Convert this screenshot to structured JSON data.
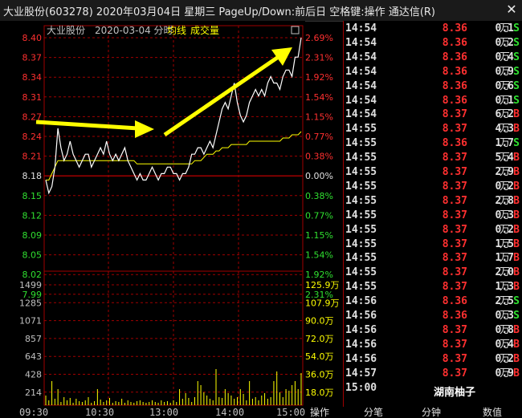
{
  "window": {
    "title": "大业股份(603278) 2020年03月04日 星期三 PageUp/Down:前后日 空格键:操作 通达信(R)",
    "close_label": "✕"
  },
  "chart": {
    "stock_name": "大业股份",
    "date": "2020-03-04 分时",
    "avg_line_label": "均线",
    "volume_label": "成交量",
    "base_price": 8.18
  },
  "chart_data": {
    "type": "line",
    "price_ticks": [
      "8.40",
      "8.37",
      "8.34",
      "8.31",
      "8.27",
      "8.24",
      "8.21",
      "8.18",
      "8.15",
      "8.12",
      "8.09",
      "8.05",
      "8.02",
      "7.99"
    ],
    "pct_ticks": [
      "2.69%",
      "2.31%",
      "1.92%",
      "1.54%",
      "1.15%",
      "0.77%",
      "0.38%",
      "0.00%",
      "0.38%",
      "0.77%",
      "1.15%",
      "1.54%",
      "1.92%",
      "2.31%"
    ],
    "volume_ticks": [
      "1499",
      "1285",
      "1071",
      "857",
      "643",
      "428",
      "214"
    ],
    "volume_amount_ticks": [
      "125.9万",
      "107.9万",
      "90.0万",
      "72.0万",
      "54.0万",
      "36.0万",
      "18.0万"
    ],
    "x_ticks": [
      "09:30",
      "10:30",
      "13:00",
      "14:00",
      "15:00"
    ],
    "ylim": [
      7.96,
      8.4
    ],
    "series": [
      {
        "name": "price",
        "values": [
          8.18,
          8.16,
          8.17,
          8.2,
          8.26,
          8.23,
          8.21,
          8.22,
          8.24,
          8.22,
          8.21,
          8.2,
          8.21,
          8.22,
          8.22,
          8.2,
          8.21,
          8.22,
          8.23,
          8.22,
          8.24,
          8.22,
          8.21,
          8.22,
          8.21,
          8.22,
          8.23,
          8.21,
          8.2,
          8.19,
          8.18,
          8.19,
          8.18,
          8.18,
          8.19,
          8.2,
          8.19,
          8.18,
          8.19,
          8.19,
          8.2,
          8.2,
          8.19,
          8.19,
          8.18,
          8.19,
          8.19,
          8.2,
          8.22,
          8.22,
          8.23,
          8.23,
          8.22,
          8.23,
          8.24,
          8.23,
          8.25,
          8.27,
          8.29,
          8.3,
          8.29,
          8.31,
          8.33,
          8.3,
          8.28,
          8.27,
          8.28,
          8.3,
          8.31,
          8.32,
          8.31,
          8.32,
          8.31,
          8.33,
          8.34,
          8.33,
          8.33,
          8.32,
          8.34,
          8.35,
          8.35,
          8.34,
          8.37,
          8.37,
          8.4
        ]
      },
      {
        "name": "avg",
        "values": [
          8.18,
          8.18,
          8.19,
          8.2,
          8.21,
          8.21,
          8.21,
          8.21,
          8.21,
          8.21,
          8.21,
          8.21,
          8.21,
          8.21,
          8.21,
          8.21,
          8.21,
          8.21,
          8.21,
          8.21,
          8.21,
          8.21,
          8.21,
          8.21,
          8.21,
          8.21,
          8.21,
          8.21,
          8.21,
          8.21,
          8.205,
          8.205,
          8.205,
          8.205,
          8.205,
          8.205,
          8.205,
          8.205,
          8.205,
          8.205,
          8.205,
          8.205,
          8.205,
          8.205,
          8.205,
          8.205,
          8.205,
          8.205,
          8.205,
          8.21,
          8.21,
          8.21,
          8.215,
          8.22,
          8.22,
          8.22,
          8.225,
          8.225,
          8.23,
          8.23,
          8.23,
          8.235,
          8.235,
          8.235,
          8.235,
          8.235,
          8.235,
          8.24,
          8.24,
          8.24,
          8.24,
          8.24,
          8.24,
          8.24,
          8.24,
          8.24,
          8.24,
          8.24,
          8.245,
          8.245,
          8.245,
          8.25,
          8.25,
          8.25,
          8.255
        ]
      }
    ],
    "volumes": [
      120,
      60,
      300,
      80,
      200,
      40,
      100,
      60,
      90,
      30,
      80,
      50,
      40,
      60,
      100,
      30,
      50,
      200,
      70,
      40,
      60,
      90,
      30,
      50,
      40,
      80,
      30,
      60,
      40,
      30,
      50,
      60,
      40,
      30,
      40,
      60,
      40,
      30,
      60,
      40,
      50,
      30,
      60,
      40,
      200,
      80,
      150,
      90,
      40,
      100,
      300,
      250,
      160,
      120,
      80,
      60,
      450,
      100,
      90,
      200,
      150,
      120,
      80,
      100,
      200,
      140,
      60,
      300,
      80,
      100,
      60,
      120,
      150,
      80,
      100,
      300,
      420,
      160,
      100,
      200,
      180,
      250,
      300,
      200,
      400
    ]
  },
  "trades": [
    {
      "time": "14:54",
      "price": "8.36",
      "vol": "0.1",
      "unit": "万",
      "side": "S"
    },
    {
      "time": "14:54",
      "price": "8.36",
      "vol": "0.2",
      "unit": "万",
      "side": "S"
    },
    {
      "time": "14:54",
      "price": "8.36",
      "vol": "0.4",
      "unit": "万",
      "side": "S"
    },
    {
      "time": "14:54",
      "price": "8.36",
      "vol": "0.9",
      "unit": "万",
      "side": "S"
    },
    {
      "time": "14:54",
      "price": "8.36",
      "vol": "0.6",
      "unit": "万",
      "side": "S"
    },
    {
      "time": "14:54",
      "price": "8.36",
      "vol": "0.1",
      "unit": "万",
      "side": "S"
    },
    {
      "time": "14:54",
      "price": "8.37",
      "vol": "6.2",
      "unit": "万",
      "side": "B"
    },
    {
      "time": "14:55",
      "price": "8.37",
      "vol": "4.3",
      "unit": "万",
      "side": "B"
    },
    {
      "time": "14:55",
      "price": "8.36",
      "vol": "1.7",
      "unit": "万",
      "side": "S"
    },
    {
      "time": "14:55",
      "price": "8.37",
      "vol": "5.4",
      "unit": "万",
      "side": "B"
    },
    {
      "time": "14:55",
      "price": "8.37",
      "vol": "2.9",
      "unit": "万",
      "side": "B"
    },
    {
      "time": "14:55",
      "price": "8.37",
      "vol": "0.2",
      "unit": "万",
      "side": "B"
    },
    {
      "time": "14:55",
      "price": "8.37",
      "vol": "2.8",
      "unit": "万",
      "side": "B"
    },
    {
      "time": "14:55",
      "price": "8.37",
      "vol": "0.3",
      "unit": "万",
      "side": "B"
    },
    {
      "time": "14:55",
      "price": "8.37",
      "vol": "0.2",
      "unit": "万",
      "side": "B"
    },
    {
      "time": "14:55",
      "price": "8.37",
      "vol": "1.5",
      "unit": "万",
      "side": "B"
    },
    {
      "time": "14:55",
      "price": "8.37",
      "vol": "1.7",
      "unit": "万",
      "side": "B"
    },
    {
      "time": "14:55",
      "price": "8.37",
      "vol": "2.0",
      "unit": "万",
      "side": "B"
    },
    {
      "time": "14:55",
      "price": "8.37",
      "vol": "1.3",
      "unit": "万",
      "side": "B"
    },
    {
      "time": "14:56",
      "price": "8.36",
      "vol": "2.5",
      "unit": "万",
      "side": "S"
    },
    {
      "time": "14:56",
      "price": "8.36",
      "vol": "0.3",
      "unit": "万",
      "side": "S"
    },
    {
      "time": "14:56",
      "price": "8.37",
      "vol": "0.8",
      "unit": "万",
      "side": "B"
    },
    {
      "time": "14:56",
      "price": "8.37",
      "vol": "0.4",
      "unit": "万",
      "side": "B"
    },
    {
      "time": "14:56",
      "price": "8.37",
      "vol": "0.2",
      "unit": "万",
      "side": "B"
    },
    {
      "time": "14:57",
      "price": "8.37",
      "vol": "0.9",
      "unit": "万",
      "side": "B"
    },
    {
      "time": "15:00",
      "price": "",
      "vol": "",
      "unit": "",
      "side": ""
    }
  ],
  "tabs": [
    "操作",
    "分笔",
    "分钟",
    "数值"
  ],
  "watermark": "湖南柚子",
  "colors": {
    "up": "#ff3030",
    "down": "#30e030",
    "price_line": "#ffffff",
    "avg_line": "#ffff00",
    "grid": "#a00000",
    "volume": "#ffff00",
    "arrow": "#ffff00"
  }
}
